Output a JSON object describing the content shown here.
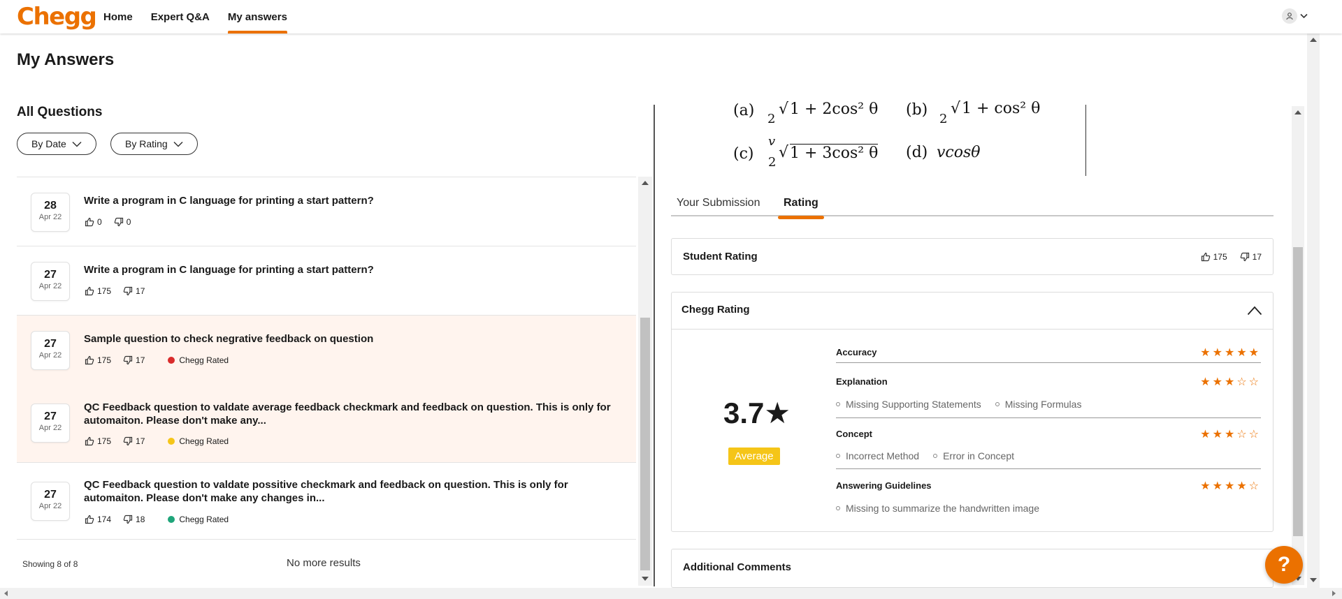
{
  "nav": {
    "logo": "Chegg",
    "links": [
      "Home",
      "Expert Q&A",
      "My answers"
    ],
    "active": "My answers"
  },
  "page": {
    "title": "My Answers"
  },
  "list": {
    "section_title": "All Questions",
    "filters": {
      "by_date": "By Date",
      "by_rating": "By Rating"
    },
    "items": [
      {
        "day": "28",
        "month": "Apr 22",
        "title": "Write a program in C language for printing a start pattern?",
        "likes": "0",
        "dislikes": "0",
        "chegg_rated": "",
        "rated_color": ""
      },
      {
        "day": "27",
        "month": "Apr 22",
        "title": "Write a program in C language for printing a start pattern?",
        "likes": "175",
        "dislikes": "17",
        "chegg_rated": "",
        "rated_color": ""
      },
      {
        "day": "27",
        "month": "Apr 22",
        "title": "Sample question to check negrative feedback on question",
        "likes": "175",
        "dislikes": "17",
        "chegg_rated": "Chegg Rated",
        "rated_color": "#d92b2b"
      },
      {
        "day": "27",
        "month": "Apr 22",
        "title": "QC Feedback question to valdate average feedback checkmark and feedback on question. This is only for automaiton. Please don't make any...",
        "likes": "175",
        "dislikes": "17",
        "chegg_rated": "Chegg Rated",
        "rated_color": "#f5c518"
      },
      {
        "day": "27",
        "month": "Apr 22",
        "title": "QC Feedback question to valdate possitive checkmark and feedback on question. This is only for automaiton. Please don't make any changes in...",
        "likes": "174",
        "dislikes": "18",
        "chegg_rated": "Chegg Rated",
        "rated_color": "#1fa57a"
      }
    ],
    "showing": "Showing 8 of 8",
    "no_more": "No more results"
  },
  "formula": {
    "a_label": "(a)",
    "a_text": "1 + 2cos² θ",
    "b_label": "(b)",
    "b_text": "1 + cos² θ",
    "c_label": "(c)",
    "c_num": "v",
    "c_den": "2",
    "c_text": "1 + 3cos² θ",
    "d_label": "(d)",
    "d_text": "vcosθ"
  },
  "tabs": {
    "submission": "Your Submission",
    "rating": "Rating",
    "active": "Rating"
  },
  "student_rating": {
    "label": "Student Rating",
    "likes": "175",
    "dislikes": "17"
  },
  "chegg_rating": {
    "label": "Chegg Rating",
    "score": "3.7★",
    "badge": "Average",
    "badge_color": "#f5c518",
    "criteria": [
      {
        "name": "Accuracy",
        "stars": 5,
        "subs": []
      },
      {
        "name": "Explanation",
        "stars": 3,
        "subs": [
          "Missing Supporting Statements",
          "Missing Formulas"
        ]
      },
      {
        "name": "Concept",
        "stars": 3,
        "subs": [
          "Incorrect Method",
          "Error in Concept"
        ]
      },
      {
        "name": "Answering Guidelines",
        "stars": 4,
        "subs": [
          "Missing to summarize the handwritten image"
        ]
      }
    ]
  },
  "additional_comments": {
    "label": "Additional Comments"
  },
  "help": {
    "label": "?"
  },
  "colors": {
    "accent": "#eb7100",
    "highlight_row": "#fff4ee"
  }
}
